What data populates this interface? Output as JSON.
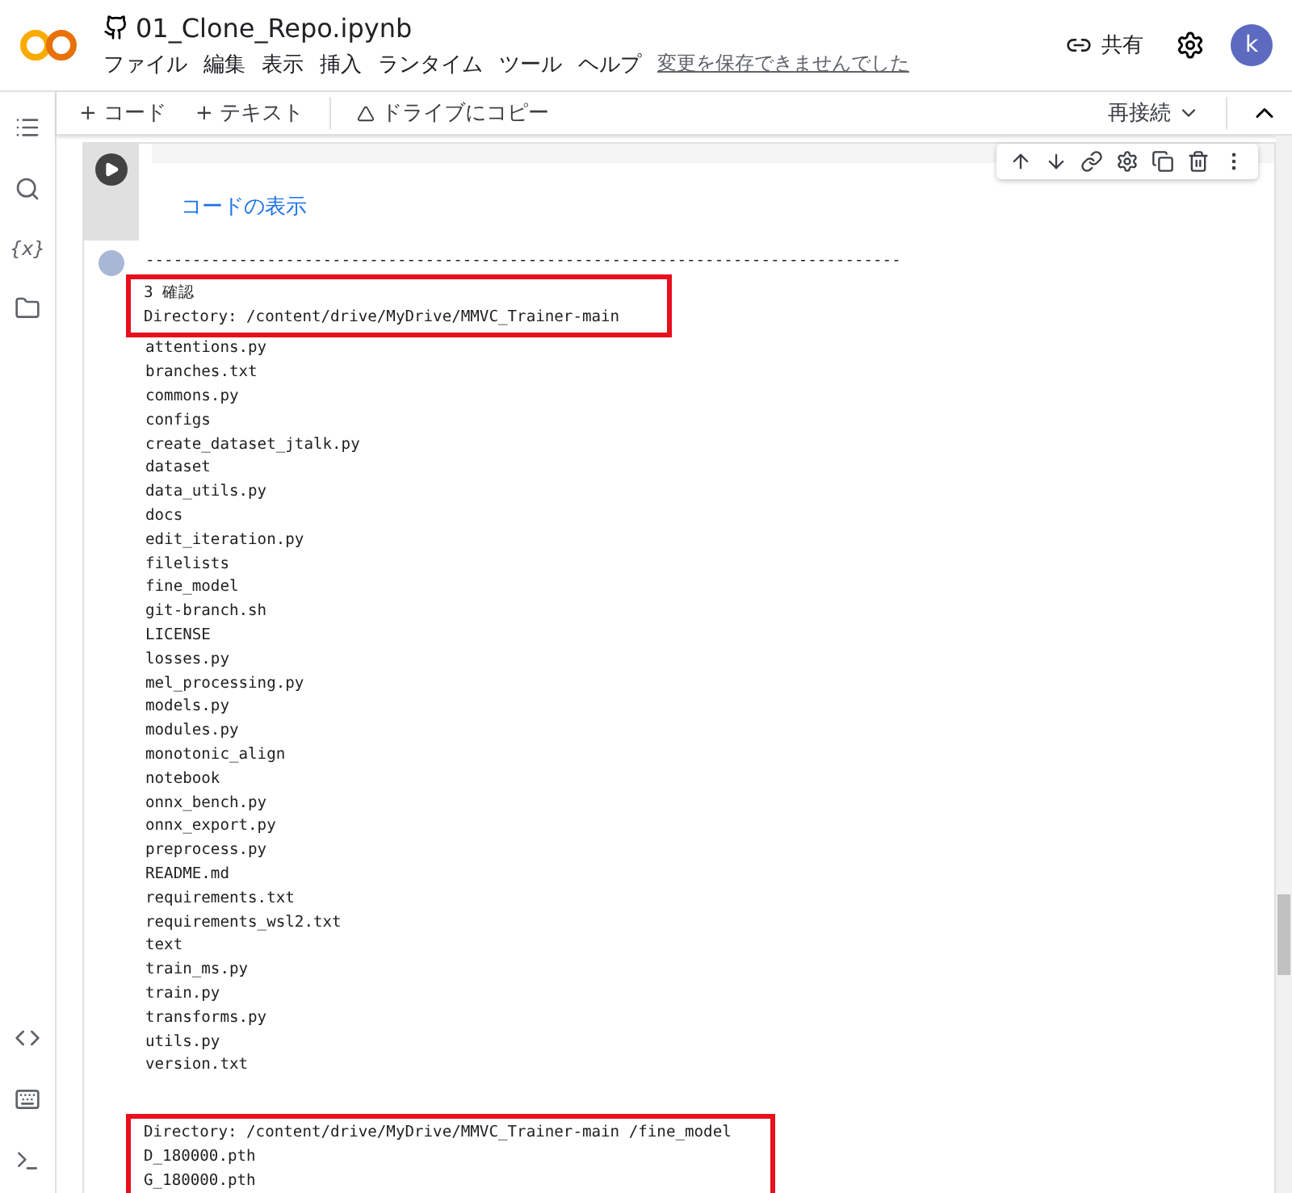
{
  "header": {
    "title": "01_Clone_Repo.ipynb",
    "menu": [
      "ファイル",
      "編集",
      "表示",
      "挿入",
      "ランタイム",
      "ツール",
      "ヘルプ"
    ],
    "save_notice": "変更を保存できませんでした",
    "share": "共有",
    "avatar": "k"
  },
  "toolbar": {
    "add_code": "+ コード",
    "add_text": "+ テキスト",
    "copy_to_drive": "ドライブにコピー",
    "reconnect": "再接続"
  },
  "sidebar": {
    "variables_label": "{x}"
  },
  "cell": {
    "show_code": "コードの表示"
  },
  "output": {
    "separator": "---------------------------------------------------------------------------------",
    "highlight_1": [
      "3 確認",
      "Directory: /content/drive/MyDrive/MMVC_Trainer-main"
    ],
    "files": [
      "attentions.py",
      "branches.txt",
      "commons.py",
      "configs",
      "create_dataset_jtalk.py",
      "dataset",
      "data_utils.py",
      "docs",
      "edit_iteration.py",
      "filelists",
      "fine_model",
      "git-branch.sh",
      "LICENSE",
      "losses.py",
      "mel_processing.py",
      "models.py",
      "modules.py",
      "monotonic_align",
      "notebook",
      "onnx_bench.py",
      "onnx_export.py",
      "preprocess.py",
      "README.md",
      "requirements.txt",
      "requirements_wsl2.txt",
      "text",
      "train_ms.py",
      "train.py",
      "transforms.py",
      "utils.py",
      "version.txt"
    ],
    "highlight_2": [
      "Directory: /content/drive/MyDrive/MMVC_Trainer-main /fine_model",
      "D_180000.pth",
      "G_180000.pth"
    ]
  }
}
